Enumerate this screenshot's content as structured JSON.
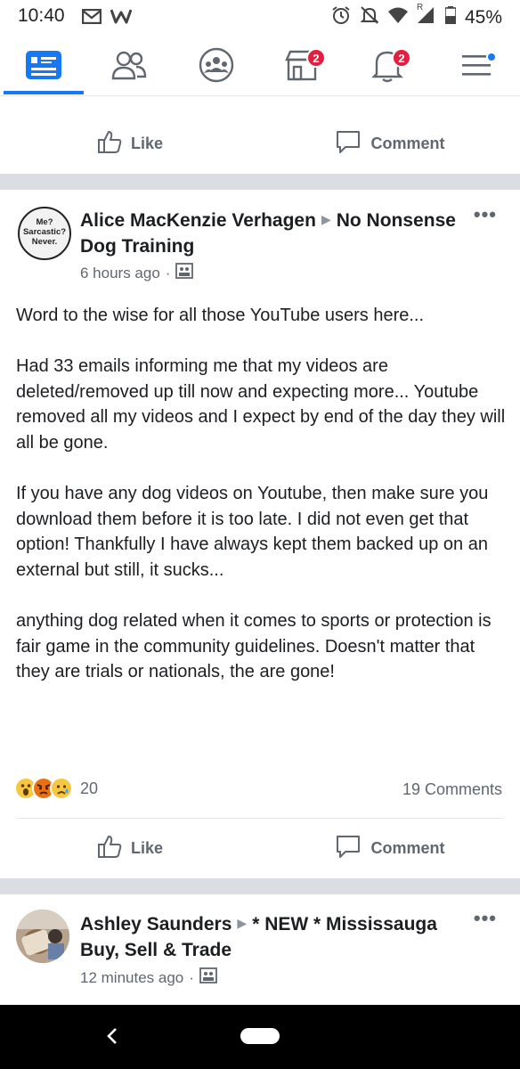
{
  "status_bar": {
    "time": "10:40",
    "battery_pct": "45%",
    "signal_label": "R"
  },
  "nav": {
    "items": [
      {
        "name": "news-feed",
        "active": true
      },
      {
        "name": "friends",
        "active": false
      },
      {
        "name": "groups",
        "active": false
      },
      {
        "name": "marketplace",
        "badge": "2"
      },
      {
        "name": "notifications",
        "badge": "2"
      },
      {
        "name": "menu",
        "dot": true
      }
    ]
  },
  "actions": {
    "like_label": "Like",
    "comment_label": "Comment"
  },
  "post1": {
    "avatar_text": [
      "Me?",
      "Sarcastic?",
      "Never."
    ],
    "author": "Alice MacKenzie Verhagen",
    "group": "No Nonsense Dog Training",
    "time": "6 hours ago",
    "paragraphs": [
      "Word to the wise for all those YouTube users here...",
      "Had 33 emails informing me that my videos are deleted/removed up till now and expecting more... Youtube removed all my videos and I expect by end of the day they will all be gone.",
      "If you have any dog videos on Youtube, then make sure you download them before it is too late. I did not even get that option! Thankfully I have always kept them backed up on an external but still, it sucks...",
      "anything dog related when it comes to sports or protection is fair game in the community guidelines. Doesn't matter that they are trials or nationals, the are gone!"
    ],
    "reaction_count": "20",
    "comments": "19 Comments"
  },
  "post2": {
    "author": "Ashley Saunders",
    "group": "* NEW * Mississauga Buy, Sell & Trade",
    "time": "12 minutes ago"
  },
  "colors": {
    "accent": "#1877f2",
    "badge": "#e41e3f",
    "separator": "#dadde1"
  }
}
